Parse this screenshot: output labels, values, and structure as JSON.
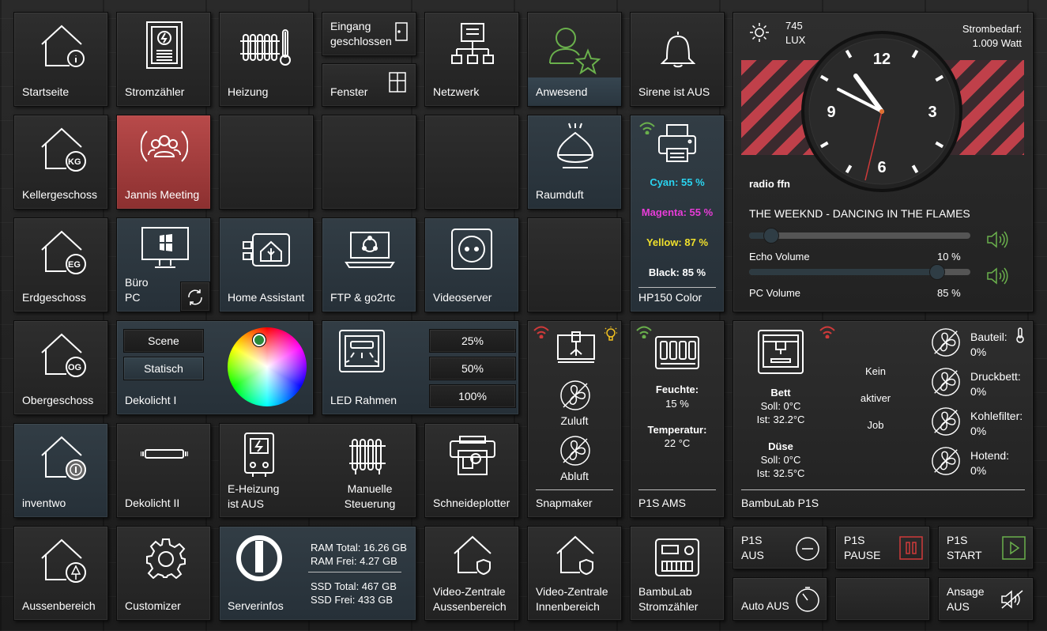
{
  "tiles": {
    "startseite": "Startseite",
    "stromzaehler": "Stromzähler",
    "heizung": "Heizung",
    "eingang": "Eingang geschlossen",
    "eingang_l1": "Eingang",
    "eingang_l2": "geschlossen",
    "fenster": "Fenster",
    "netzwerk": "Netzwerk",
    "anwesend": "Anwesend",
    "sirene": "Sirene ist AUS",
    "kellergeschoss": "Kellergeschoss",
    "kg": "KG",
    "jannis": "Jannis Meeting",
    "raumduft": "Raumduft",
    "erdgeschoss": "Erdgeschoss",
    "eg": "EG",
    "buero_l1": "Büro",
    "buero_l2": "PC",
    "home_assistant": "Home Assistant",
    "ftp": "FTP & go2rtc",
    "videoserver": "Videoserver",
    "obergeschoss": "Obergeschoss",
    "og": "OG",
    "dekolicht1": "Dekolicht I",
    "scene_btn": "Scene",
    "statisch_btn": "Statisch",
    "led_rahmen": "LED Rahmen",
    "pct25": "25%",
    "pct50": "50%",
    "pct100": "100%",
    "inventwo": "inventwo",
    "dekolicht2": "Dekolicht II",
    "eheizung_l1": "E-Heizung",
    "eheizung_l2": "ist AUS",
    "manuelle_l1": "Manuelle",
    "manuelle_l2": "Steuerung",
    "schneideplotter": "Schneideplotter",
    "aussenbereich": "Aussenbereich",
    "customizer": "Customizer",
    "serverinfos": "Serverinfos",
    "video_aussen_l1": "Video-Zentrale",
    "video_aussen_l2": "Aussenbereich",
    "video_innen_l1": "Video-Zentrale",
    "video_innen_l2": "Innenbereich",
    "bambu_strom_l1": "BambuLab",
    "bambu_strom_l2": "Stromzähler"
  },
  "printer": {
    "cyan": "Cyan: 55 %",
    "magenta": "Magenta: 55 %",
    "yellow": "Yellow: 87 %",
    "black": "Black: 85 %",
    "name": "HP150 Color"
  },
  "server": {
    "ram_total": "RAM Total: 16.26 GB",
    "ram_free": "RAM Frei: 4.27 GB",
    "ssd_total": "SSD Total: 467 GB",
    "ssd_free": "SSD Frei: 433 GB"
  },
  "snapmaker": {
    "zuluft": "Zuluft",
    "abluft": "Abluft",
    "name": "Snapmaker"
  },
  "ams": {
    "feuchte_label": "Feuchte:",
    "feuchte_value": "15 %",
    "temp_label": "Temperatur:",
    "temp_value": "22 °C",
    "name": "P1S AMS"
  },
  "bambu": {
    "bett": "Bett",
    "bett_soll": "Soll: 0°C",
    "bett_ist": "Ist: 32.2°C",
    "duese": "Düse",
    "duese_soll": "Soll: 0°C",
    "duese_ist": "Ist: 32.5°C",
    "job_l1": "Kein",
    "job_l2": "aktiver",
    "job_l3": "Job",
    "bauteil_label": "Bauteil:",
    "bauteil_value": "0%",
    "druckbett_label": "Druckbett:",
    "druckbett_value": "0%",
    "kohlefilter_label": "Kohlefilter:",
    "kohlefilter_value": "0%",
    "hotend_label": "Hotend:",
    "hotend_value": "0%",
    "name": "BambuLab P1S"
  },
  "p1s": {
    "aus_l1": "P1S",
    "aus_l2": "AUS",
    "pause_l1": "P1S",
    "pause_l2": "PAUSE",
    "start_l1": "P1S",
    "start_l2": "START",
    "auto_aus": "Auto AUS",
    "ansage_l1": "Ansage",
    "ansage_l2": "AUS"
  },
  "media": {
    "lux_value": "745",
    "lux_unit": "LUX",
    "strom_label": "Strombedarf:",
    "strom_value": "1.009 Watt",
    "radio": "radio ffn",
    "track": "THE WEEKND - DANCING IN THE FLAMES",
    "echo_label": "Echo Volume",
    "echo_value": "10 %",
    "echo_level": 0.1,
    "pc_label": "PC Volume",
    "pc_value": "85 %",
    "pc_level": 0.85,
    "clock_12": "12",
    "clock_3": "3",
    "clock_6": "6",
    "clock_9": "9"
  },
  "colors": {
    "accent_green": "#6ab04c",
    "jannis_red": "#b84a4a",
    "cyan": "#2ad4f0",
    "magenta": "#e83cd8",
    "yellow": "#f0e02c",
    "wifi_red": "#d03a3a",
    "p1s_pause_red": "#d03a3a",
    "p1s_start_green": "#6ab04c"
  }
}
